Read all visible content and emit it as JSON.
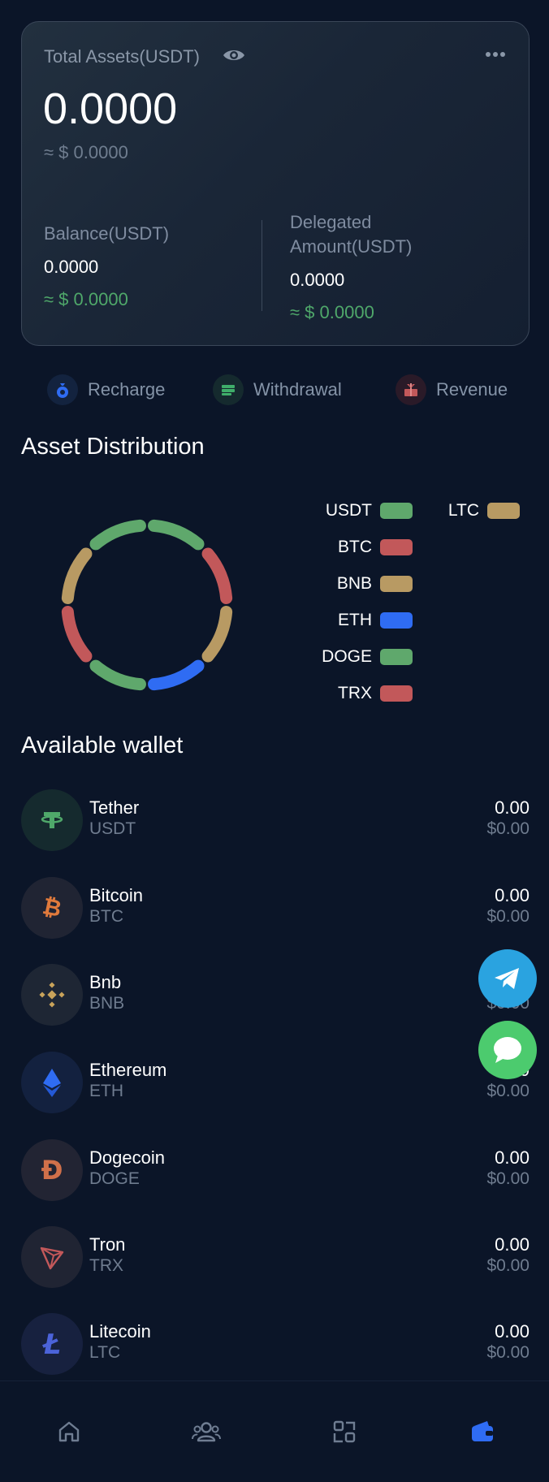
{
  "assets": {
    "label": "Total Assets(USDT)",
    "total": "0.0000",
    "approx": "≈ $ 0.0000",
    "balance_label": "Balance(USDT)",
    "balance_value": "0.0000",
    "balance_approx": "≈ $ 0.0000",
    "delegated_label_1": "Delegated",
    "delegated_label_2": "Amount(USDT)",
    "delegated_value": "0.0000",
    "delegated_approx": "≈ $ 0.0000"
  },
  "actions": {
    "recharge": "Recharge",
    "withdrawal": "Withdrawal",
    "revenue": "Revenue"
  },
  "distribution": {
    "title": "Asset Distribution",
    "legend": [
      {
        "label": "USDT",
        "color": "#5fa86c"
      },
      {
        "label": "BTC",
        "color": "#c2585a"
      },
      {
        "label": "BNB",
        "color": "#b89a63"
      },
      {
        "label": "ETH",
        "color": "#2f6cf3"
      },
      {
        "label": "DOGE",
        "color": "#5fa86c"
      },
      {
        "label": "TRX",
        "color": "#c2585a"
      },
      {
        "label": "LTC",
        "color": "#b89a63"
      }
    ]
  },
  "wallet": {
    "title": "Available wallet",
    "coins": [
      {
        "name": "Tether",
        "symbol": "USDT",
        "amount": "0.00",
        "usd": "$0.00",
        "icon": "tether-icon"
      },
      {
        "name": "Bitcoin",
        "symbol": "BTC",
        "amount": "0.00",
        "usd": "$0.00",
        "icon": "bitcoin-icon"
      },
      {
        "name": "Bnb",
        "symbol": "BNB",
        "amount": "0.00",
        "usd": "$0.00",
        "icon": "bnb-icon"
      },
      {
        "name": "Ethereum",
        "symbol": "ETH",
        "amount": "0.00",
        "usd": "$0.00",
        "icon": "ethereum-icon"
      },
      {
        "name": "Dogecoin",
        "symbol": "DOGE",
        "amount": "0.00",
        "usd": "$0.00",
        "icon": "dogecoin-icon"
      },
      {
        "name": "Tron",
        "symbol": "TRX",
        "amount": "0.00",
        "usd": "$0.00",
        "icon": "tron-icon"
      },
      {
        "name": "Litecoin",
        "symbol": "LTC",
        "amount": "0.00",
        "usd": "$0.00",
        "icon": "litecoin-icon"
      }
    ]
  },
  "nav": {
    "items": [
      "home-icon",
      "team-icon",
      "apps-icon",
      "wallet-icon"
    ],
    "active": "wallet-icon",
    "active_color": "#2f6cf3"
  }
}
